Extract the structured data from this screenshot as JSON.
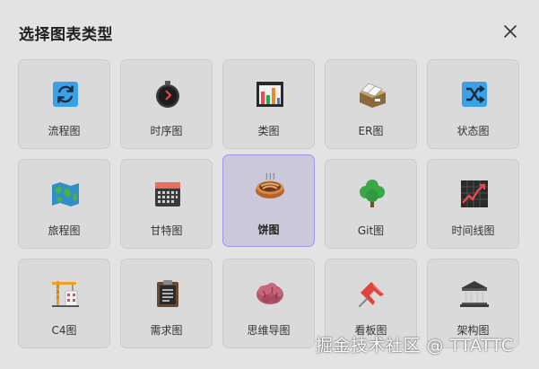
{
  "dialog": {
    "title": "选择图表类型",
    "close_icon": "close-icon"
  },
  "colors": {
    "selected_bg": "#cbc9d9",
    "selected_border": "#9a98e8",
    "card_bg": "#dadada",
    "accent_blue": "#3aa0e8"
  },
  "chart_types": [
    {
      "label": "流程图",
      "icon": "flowchart-icon",
      "selected": false
    },
    {
      "label": "时序图",
      "icon": "stopwatch-icon",
      "selected": false
    },
    {
      "label": "类图",
      "icon": "bar-chart-icon",
      "selected": false
    },
    {
      "label": "ER图",
      "icon": "file-box-icon",
      "selected": false
    },
    {
      "label": "状态图",
      "icon": "shuffle-icon",
      "selected": false
    },
    {
      "label": "旅程图",
      "icon": "map-icon",
      "selected": false
    },
    {
      "label": "甘特图",
      "icon": "calendar-icon",
      "selected": false
    },
    {
      "label": "饼图",
      "icon": "pie-icon",
      "selected": true
    },
    {
      "label": "Git图",
      "icon": "tree-icon",
      "selected": false
    },
    {
      "label": "时间线图",
      "icon": "trend-chart-icon",
      "selected": false
    },
    {
      "label": "C4图",
      "icon": "crane-icon",
      "selected": false
    },
    {
      "label": "需求图",
      "icon": "clipboard-icon",
      "selected": false
    },
    {
      "label": "思维导图",
      "icon": "brain-icon",
      "selected": false
    },
    {
      "label": "看板图",
      "icon": "pushpin-icon",
      "selected": false
    },
    {
      "label": "架构图",
      "icon": "classical-building-icon",
      "selected": false
    }
  ],
  "watermark": "掘金技术社区 @ TTATTC"
}
